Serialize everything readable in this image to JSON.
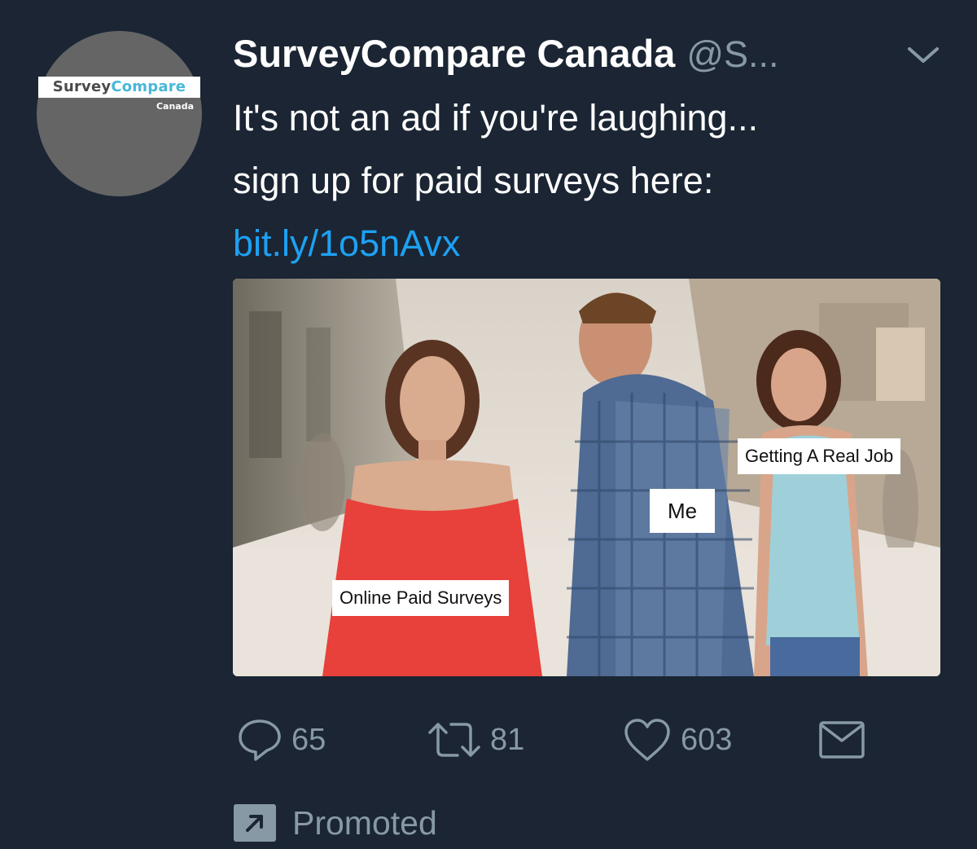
{
  "avatar": {
    "logo_word1": "Survey",
    "logo_word2": "Compare",
    "logo_sub": "Canada"
  },
  "tweet": {
    "display_name": "SurveyCompare Canada",
    "handle": "@S...",
    "text_line1": "It's not an ad if you're laughing...",
    "text_line2": "sign up for paid surveys here:",
    "link": "bit.ly/1o5nAvx"
  },
  "media": {
    "captions": {
      "left": "Online Paid Surveys",
      "center": "Me",
      "right": "Getting A Real Job"
    }
  },
  "actions": {
    "reply_count": "65",
    "retweet_count": "81",
    "like_count": "603"
  },
  "footer": {
    "promoted_label": "Promoted"
  },
  "icons": {
    "menu": "chevron-down-icon",
    "reply": "reply-icon",
    "retweet": "retweet-icon",
    "like": "heart-icon",
    "dm": "envelope-icon",
    "promoted": "promoted-arrow-icon"
  },
  "colors": {
    "background": "#1b2533",
    "link": "#1da1f2",
    "muted": "#8899a6",
    "logo_accent": "#49b7d8"
  }
}
